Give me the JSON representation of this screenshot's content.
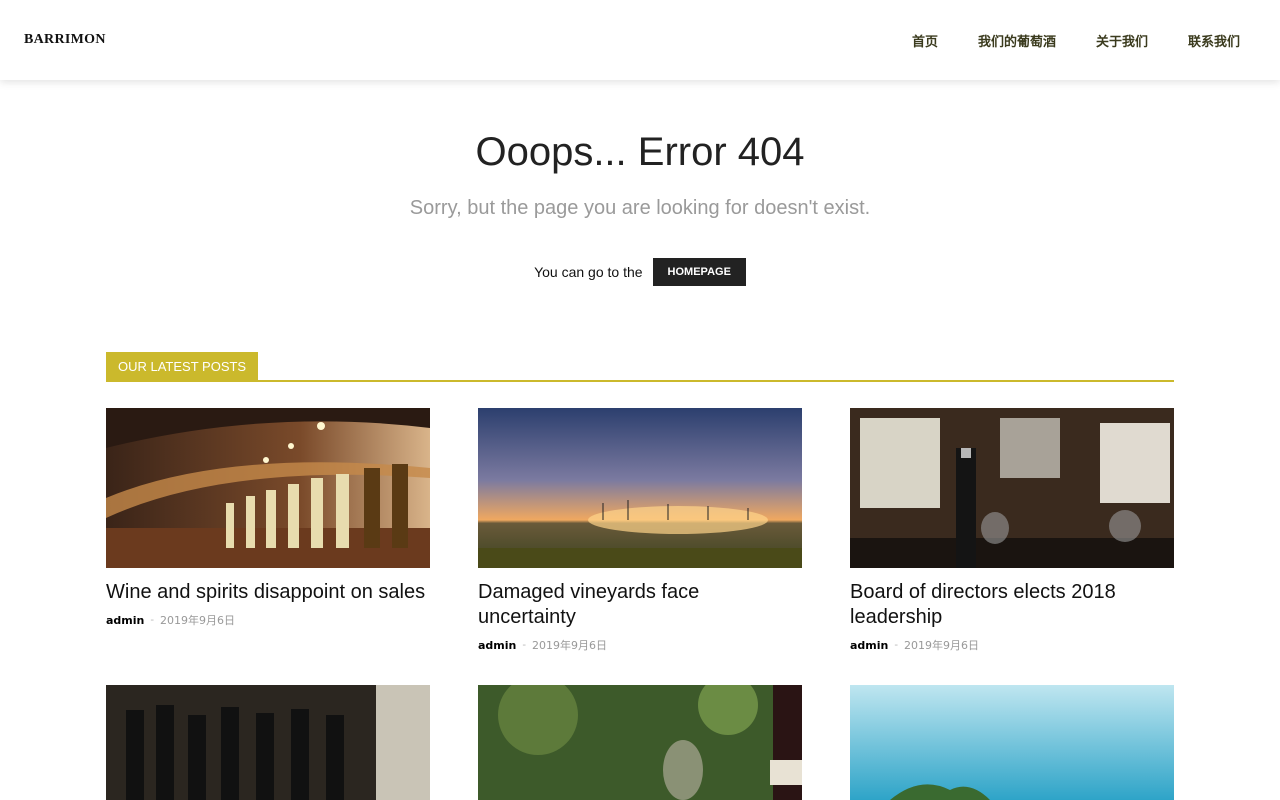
{
  "header": {
    "logo": "BARRIMON",
    "nav": [
      "首页",
      "我们的葡萄酒",
      "关于我们",
      "联系我们"
    ]
  },
  "error": {
    "title": "Ooops... Error 404",
    "subtitle": "Sorry, but the page you are looking for doesn't exist.",
    "go_text": "You can go to the",
    "homepage_label": "HOMEPAGE"
  },
  "latest": {
    "heading": "OUR LATEST POSTS",
    "posts": [
      {
        "title": "Wine and spirits disappoint on sales",
        "author": "admin",
        "sep": "-",
        "date": "2019年9月6日"
      },
      {
        "title": "Damaged vineyards face uncertainty",
        "author": "admin",
        "sep": "-",
        "date": "2019年9月6日"
      },
      {
        "title": "Board of directors elects 2018 leadership",
        "author": "admin",
        "sep": "-",
        "date": "2019年9月6日"
      }
    ]
  },
  "colors": {
    "accent": "#cbb92c",
    "nav_text": "#3b3b1e",
    "button_bg": "#222222"
  }
}
